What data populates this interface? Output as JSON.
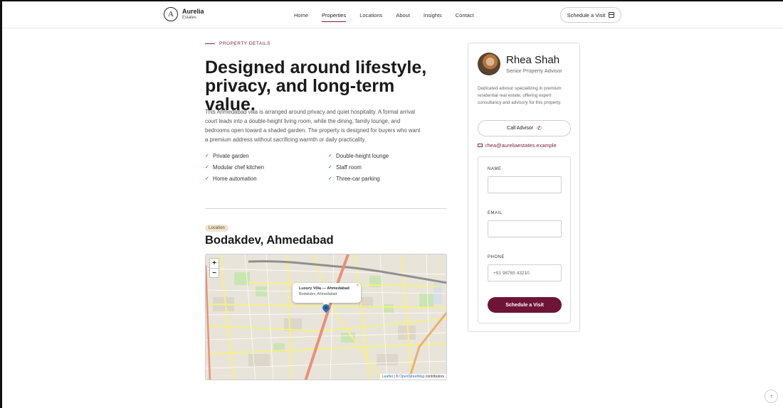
{
  "brand": {
    "mark": "A",
    "name": "Aurelia",
    "sub": "Estates"
  },
  "nav": {
    "items": [
      "Home",
      "Properties",
      "Locations",
      "About",
      "Insights",
      "Contact"
    ],
    "active": "Properties"
  },
  "header": {
    "cta_label": "Schedule a Visit",
    "cta_icon": "calendar-icon"
  },
  "details": {
    "eyebrow": "PROPERTY DETAILS",
    "headline": "Designed around lifestyle, privacy, and long-term value.",
    "description": "This Ahmedabad villa is arranged around privacy and quiet hospitality. A formal arrival court leads into a double-height living room, while the dining, family lounge, and bedrooms open toward a shaded garden. The property is designed for buyers who want a premium address without sacrificing warmth or daily practicality.",
    "features": [
      "Private garden",
      "Double-height lounge",
      "Modular chef kitchen",
      "Staff room",
      "Home automation",
      "Three-car parking"
    ]
  },
  "location": {
    "badge": "Location",
    "title": "Bodakdev, Ahmedabad",
    "map": {
      "zoom_in": "+",
      "zoom_out": "−",
      "popup_title": "Luxury Villa — Ahmedabad",
      "popup_subtitle": "Bodakdev, Ahmedabad",
      "popup_close": "×",
      "attribution_leaflet": "Leaflet",
      "attribution_sep": " | © ",
      "attribution_osm": "OpenStreetMap",
      "attribution_tail": " contributors"
    }
  },
  "advisor": {
    "name": "Rhea Shah",
    "role": "Senior Property Advisor",
    "bio": "Dedicated advisor specializing in premium residential real estate, offering expert consultancy and advisory for this property.",
    "call_label": "Call Advisor",
    "email": "rhea@aureliaestates.example"
  },
  "form": {
    "name_label": "NAME",
    "email_label": "EMAIL",
    "phone_label": "PHONE",
    "phone_placeholder": "+91 98765 43210",
    "submit_label": "Schedule a Visit"
  },
  "scroll_top": "↑",
  "colors": {
    "accent": "#6e1437",
    "eyebrow": "#7a1f3a",
    "badge": "#efe3cf"
  }
}
